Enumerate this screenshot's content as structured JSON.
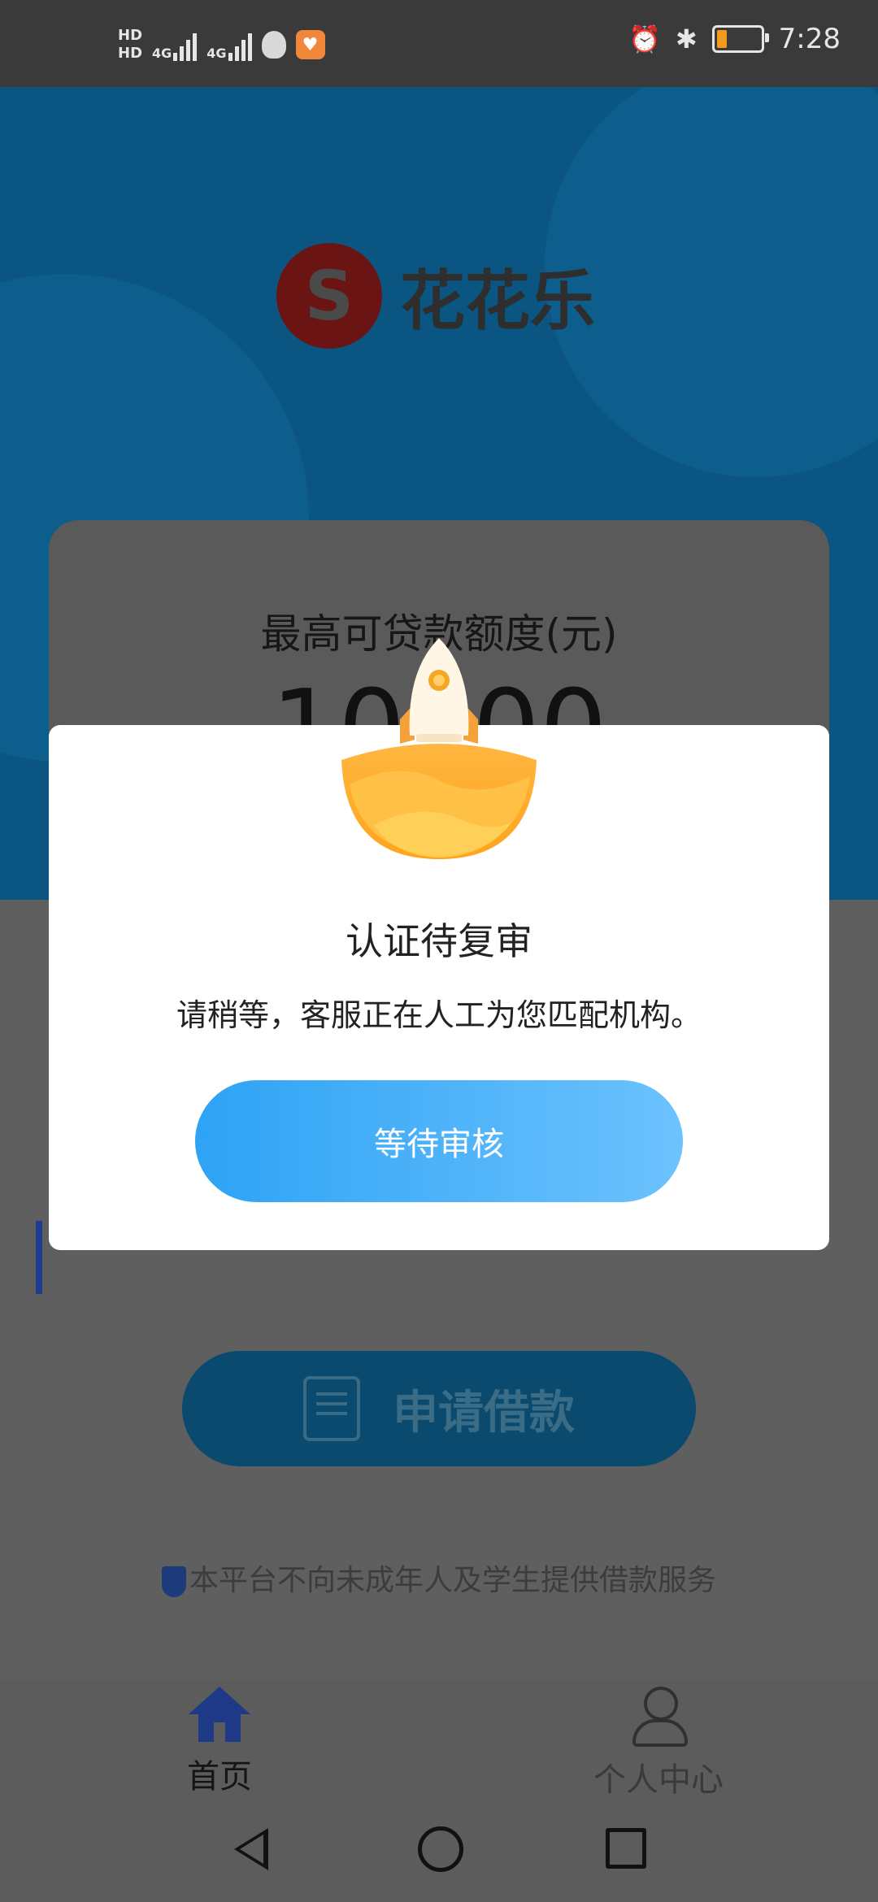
{
  "status_bar": {
    "hd1": "HD",
    "hd2": "HD",
    "net1": "4G",
    "net2": "4G",
    "time": "7:28"
  },
  "brand": {
    "name": "花花乐"
  },
  "loan_card": {
    "title": "最高可贷款额度(元)",
    "amount": "10000"
  },
  "apply_button": {
    "label": "申请借款"
  },
  "notice": "本平台不向未成年人及学生提供借款服务",
  "bottom_nav": {
    "home": "首页",
    "profile": "个人中心"
  },
  "modal": {
    "title": "认证待复审",
    "message": "请稍等，客服正在人工为您匹配机构。",
    "button": "等待审核"
  },
  "colors": {
    "accent_button_start": "#2ea3f5",
    "accent_button_end": "#6cc2fd",
    "nav_active": "#1e3a86"
  }
}
